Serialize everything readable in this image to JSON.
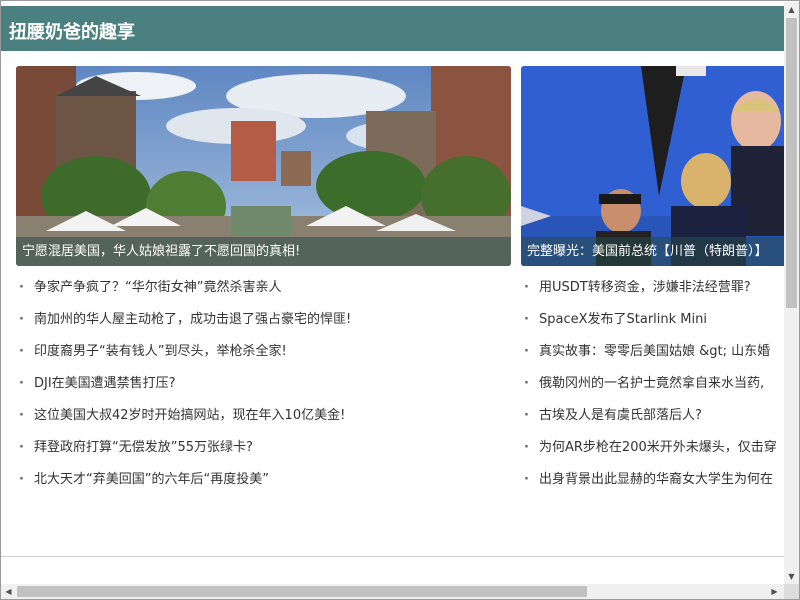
{
  "site": {
    "title": "扭腰奶爸的趣享"
  },
  "cards": [
    {
      "caption": "宁愿混居美国，华人姑娘袒露了不愿回国的真相!"
    },
    {
      "caption": "完整曝光：美国前总统【川普（特朗普）】"
    }
  ],
  "lists": [
    [
      "争家产争疯了？“华尔街女神”竟然杀害亲人",
      "南加州的华人屋主动枪了，成功击退了强占豪宅的悍匪!",
      "印度裔男子“装有钱人”到尽头，举枪杀全家!",
      "DJI在美国遭遇禁售打压?",
      "这位美国大叔42岁时开始搞网站，现在年入10亿美金!",
      "拜登政府打算“无偿发放”55万张绿卡?",
      "北大天才“弃美回国”的六年后“再度投美”"
    ],
    [
      "用USDT转移资金，涉嫌非法经营罪?",
      "SpaceX发布了Starlink Mini",
      "真实故事：零零后美国姑娘 &gt; 山东婚",
      "俄勒冈州的一名护士竟然拿自来水当药,",
      "古埃及人是有虞氏部落后人?",
      "为何AR步枪在200米开外未爆头，仅击穿",
      "出身背景出此显赫的华裔女大学生为何在"
    ]
  ],
  "scrollbar": {
    "up_icon": "▲",
    "down_icon": "▼",
    "left_icon": "◀",
    "right_icon": "▶"
  },
  "colors": {
    "header_bg": "#4a8080",
    "caption_bg": "#284b4b"
  }
}
